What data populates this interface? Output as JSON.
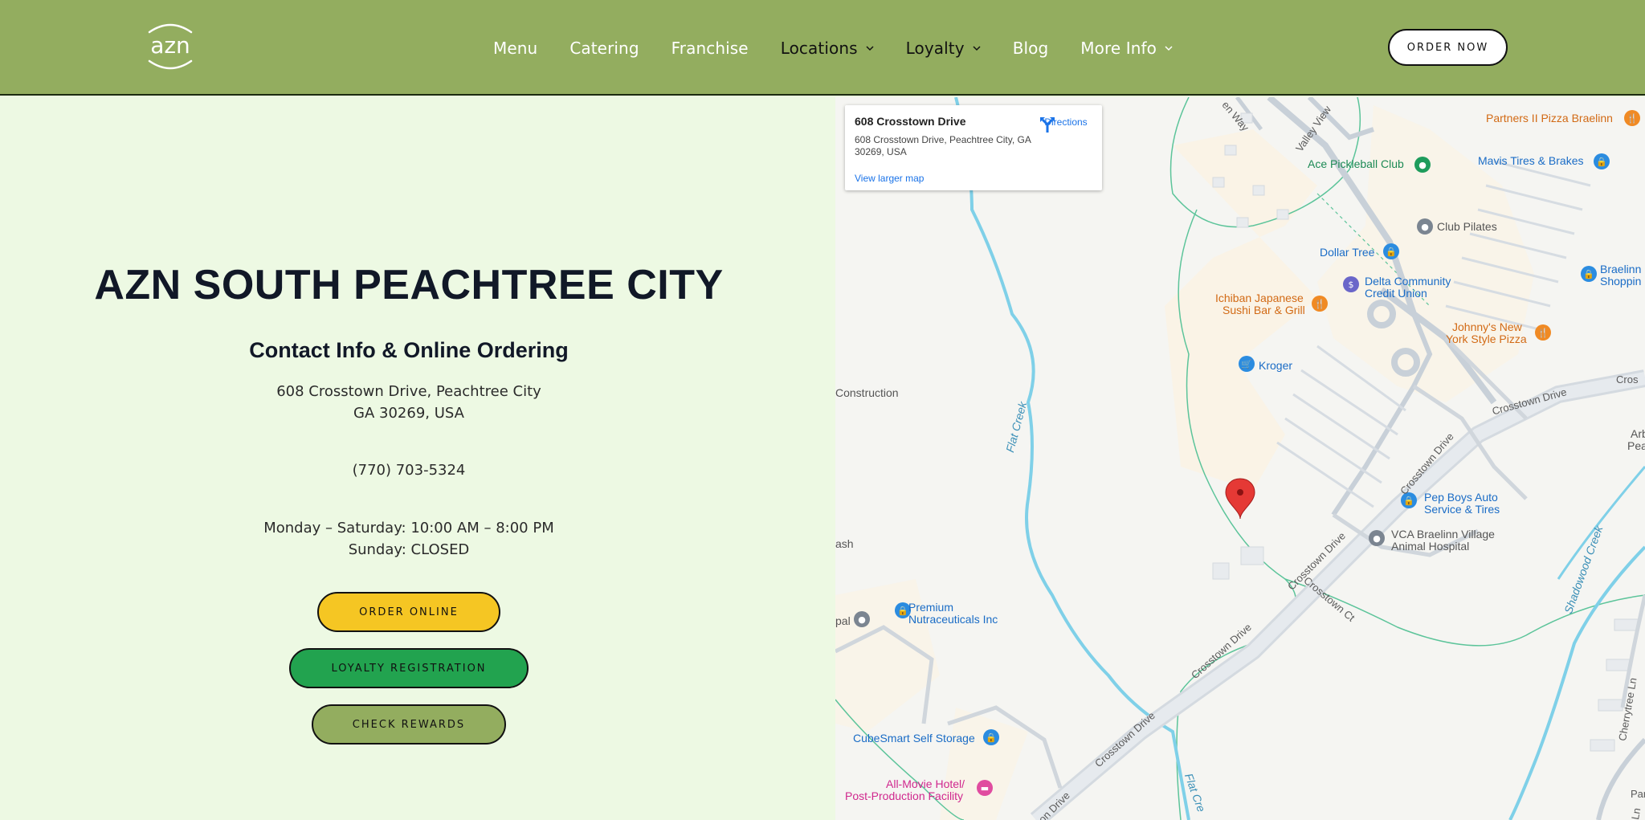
{
  "header": {
    "logo_text": "azn",
    "nav": [
      {
        "label": "Menu",
        "dropdown": false
      },
      {
        "label": "Catering",
        "dropdown": false
      },
      {
        "label": "Franchise",
        "dropdown": false
      },
      {
        "label": "Locations",
        "dropdown": true
      },
      {
        "label": "Loyalty",
        "dropdown": true
      },
      {
        "label": "Blog",
        "dropdown": false
      },
      {
        "label": "More Info",
        "dropdown": true
      }
    ],
    "order_now": "ORDER NOW"
  },
  "content": {
    "title": "AZN SOUTH PEACHTREE CITY",
    "subtitle": "Contact Info & Online Ordering",
    "address_line1": "608 Crosstown Drive, Peachtree City",
    "address_line2": "GA 30269, USA",
    "phone": "(770) 703-5324",
    "hours_line1": "Monday – Saturday: 10:00 AM – 8:00 PM",
    "hours_line2": "Sunday: CLOSED",
    "buttons": {
      "order_online": "ORDER ONLINE",
      "loyalty": "LOYALTY REGISTRATION",
      "rewards": "CHECK REWARDS"
    }
  },
  "map": {
    "card": {
      "title": "608 Crosstown Drive",
      "address": "608 Crosstown Drive, Peachtree City, GA 30269, USA",
      "directions": "Directions",
      "larger_map": "View larger map"
    },
    "labels": {
      "partners_pizza": "Partners II Pizza Braelinn",
      "ace_pickleball": "Ace Pickleball Club",
      "mavis": "Mavis Tires & Brakes",
      "club_pilates": "Club Pilates",
      "dollar_tree": "Dollar Tree",
      "braelinn": "Braelinn",
      "shopping": "Shoppin",
      "delta_1": "Delta Community",
      "delta_2": "Credit Union",
      "ichiban_1": "Ichiban Japanese",
      "ichiban_2": "Sushi Bar & Grill",
      "johnnys_1": "Johnny's New",
      "johnnys_2": "York Style Pizza",
      "kroger": "Kroger",
      "construction": "Construction",
      "ash": "ash",
      "pep_boys_1": "Pep Boys Auto",
      "pep_boys_2": "Service & Tires",
      "vca_1": "VCA Braelinn Village",
      "vca_2": "Animal Hospital",
      "premium_1": "Premium",
      "premium_2": "Nutraceuticals Inc",
      "pal": "pal",
      "cubesmart": "CubeSmart Self Storage",
      "allmovie_1": "All-Movie Hotel/",
      "allmovie_2": "Post-Production Facility",
      "flat_creek": "Flat Creek",
      "flat_creek_2": "Flat Cre",
      "shadowood": "Shadowood Creek",
      "valley_view": "Valley View",
      "en_way": "en Way",
      "crosstown_1": "Crosstown Drive",
      "crosstown_2": "Crosstown Drive",
      "crosstown_3": "Crosstown Drive",
      "crosstown_4": "Crosstown Drive",
      "crosstown_5": "Crosstown Drive",
      "crosstown_ct": "Crosstown Ct",
      "cros": "Cros",
      "arb_1": "Arb",
      "arb_2": "Pea",
      "cherrytree": "Cherrytree Ln",
      "park": "Park",
      "ln": "Ln",
      "on_drive": "on Drive"
    }
  }
}
